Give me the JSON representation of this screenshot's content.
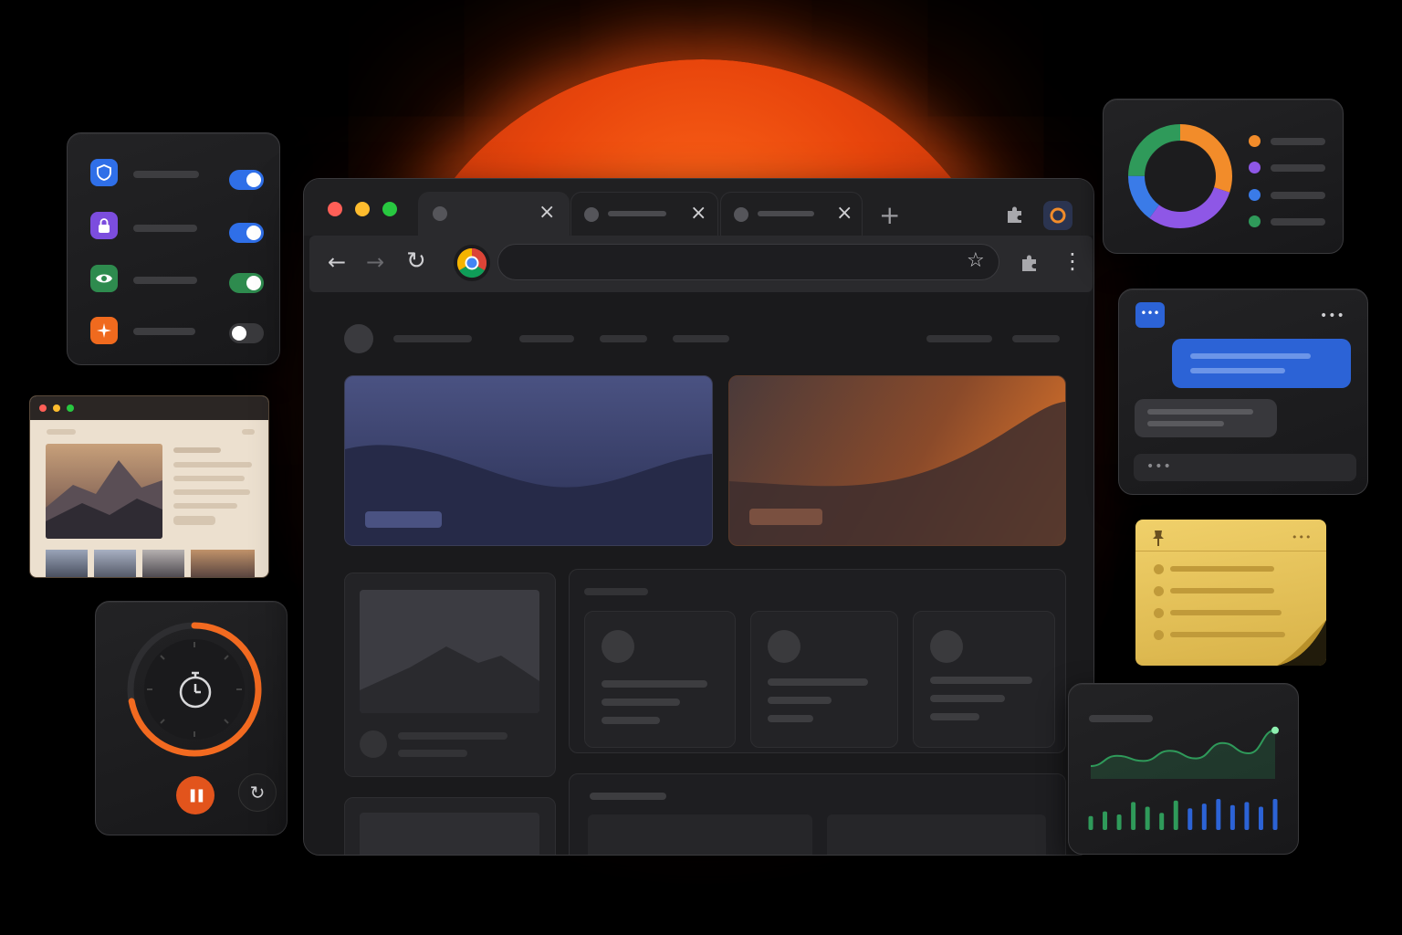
{
  "background": {
    "color": "#000000",
    "sun_color": "#e8450c"
  },
  "browser": {
    "tabs": [
      {
        "title": "",
        "close": "×"
      },
      {
        "title": "",
        "close": "×"
      },
      {
        "title": "",
        "close": "×"
      }
    ],
    "new_tab": "+",
    "address_bar": {
      "value": "",
      "placeholder": ""
    },
    "icons": {
      "back": "←",
      "forward": "→",
      "reload": "↻",
      "bookmark": "☆",
      "extensions": "puzzle-icon",
      "menu": "⋮"
    }
  },
  "security_panel": {
    "rows": [
      {
        "icon": "shield-icon",
        "color": "#2f6fe8",
        "enabled": true
      },
      {
        "icon": "lock-icon",
        "color": "#7c4dde",
        "enabled": true
      },
      {
        "icon": "eye-icon",
        "color": "#2e8b4e",
        "enabled": true
      },
      {
        "icon": "sparkle-icon",
        "color": "#f06a1e",
        "enabled": false
      }
    ]
  },
  "timer": {
    "progress": 0.72,
    "pause_symbol": "❚❚",
    "reset_symbol": "↻",
    "accent": "#f26a20"
  },
  "donut": {
    "segments": [
      {
        "color": "#f28c2a",
        "fraction": 0.3
      },
      {
        "color": "#8e57e6",
        "fraction": 0.3
      },
      {
        "color": "#3a7be8",
        "fraction": 0.15
      },
      {
        "color": "#2f9a5a",
        "fraction": 0.25
      }
    ]
  },
  "chat": {
    "menu": "•••",
    "bubble_color": "#2c63d6"
  },
  "note": {
    "menu": "•••",
    "color": "#e9c55a"
  },
  "activity": {
    "line": [
      0.25,
      0.45,
      0.35,
      0.55,
      0.4,
      0.7,
      0.5,
      0.95
    ],
    "bars": [
      0.45,
      0.6,
      0.5,
      0.9,
      0.75,
      0.55,
      0.95,
      0.7,
      0.85,
      1.0,
      0.8,
      0.9,
      0.75,
      1.0
    ],
    "green": "#2f9a5a",
    "blue": "#2c63d6"
  }
}
